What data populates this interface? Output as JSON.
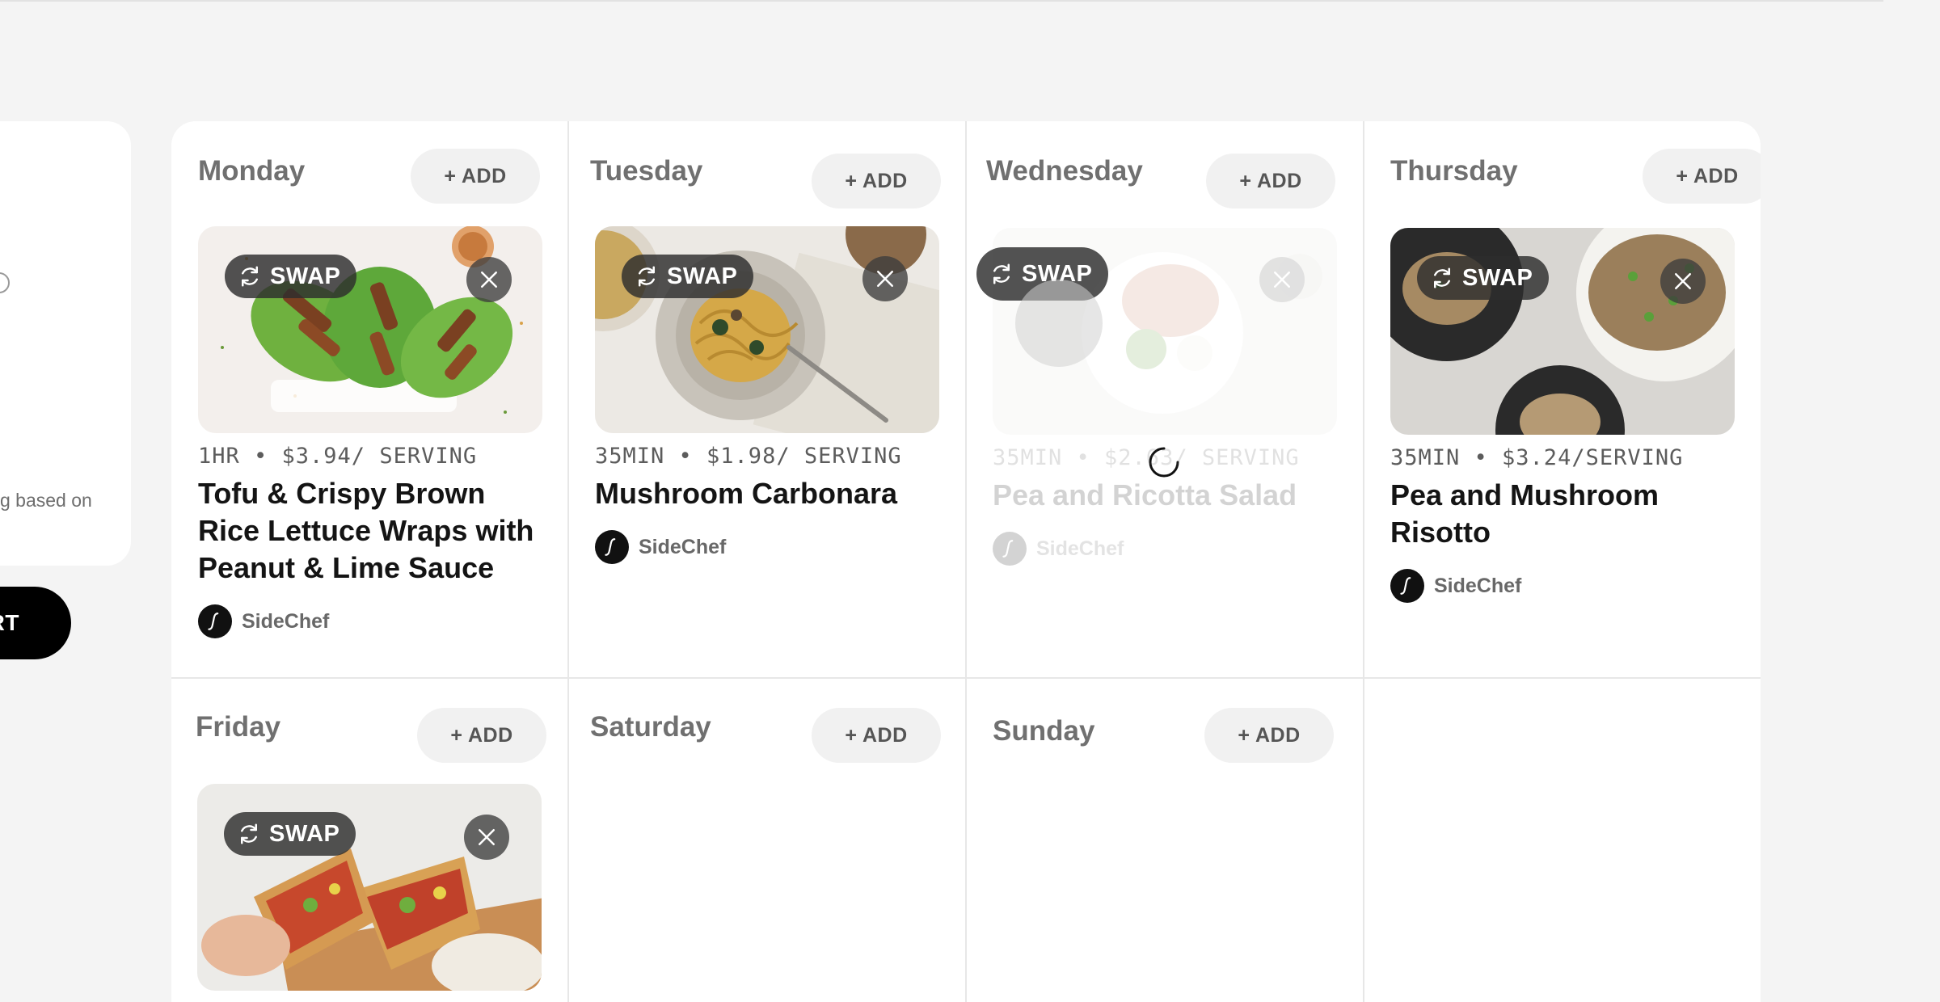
{
  "left_panel": {
    "description_fragment": "g based on",
    "cart_button": "CART"
  },
  "days": {
    "monday": {
      "name": "Monday",
      "add": "+ ADD"
    },
    "tuesday": {
      "name": "Tuesday",
      "add": "+ ADD"
    },
    "wednesday": {
      "name": "Wednesday",
      "add": "+ ADD"
    },
    "thursday": {
      "name": "Thursday",
      "add": "+ ADD"
    },
    "friday": {
      "name": "Friday",
      "add": "+ ADD"
    },
    "saturday": {
      "name": "Saturday",
      "add": "+ ADD"
    },
    "sunday": {
      "name": "Sunday",
      "add": "+ ADD"
    }
  },
  "recipes": {
    "monday": {
      "meta": "1HR • $3.94/ SERVING",
      "title": "Tofu & Crispy Brown Rice Lettuce Wraps with Peanut & Lime Sauce",
      "author": "SideChef",
      "swap": "SWAP"
    },
    "tuesday": {
      "meta": "35MIN • $1.98/ SERVING",
      "title": "Mushroom Carbonara",
      "author": "SideChef",
      "swap": "SWAP"
    },
    "wednesday": {
      "meta": "35MIN • $2.63/ SERVING",
      "title": "Pea and Ricotta Salad",
      "author": "SideChef",
      "swap": "SWAP",
      "state": "loading"
    },
    "thursday": {
      "meta": "35MIN • $3.24/SERVING",
      "title": "Pea and Mushroom Risotto",
      "author": "SideChef",
      "swap": "SWAP"
    },
    "friday": {
      "swap": "SWAP"
    }
  },
  "icons": {
    "swap": "refresh-icon",
    "remove": "close-icon",
    "author": "sidechef-logo-icon",
    "loading": "spinner-icon"
  },
  "colors": {
    "background": "#f4f4f4",
    "card": "#ffffff",
    "primary_button": "#000000",
    "overlay_button": "#2d2d2d"
  }
}
